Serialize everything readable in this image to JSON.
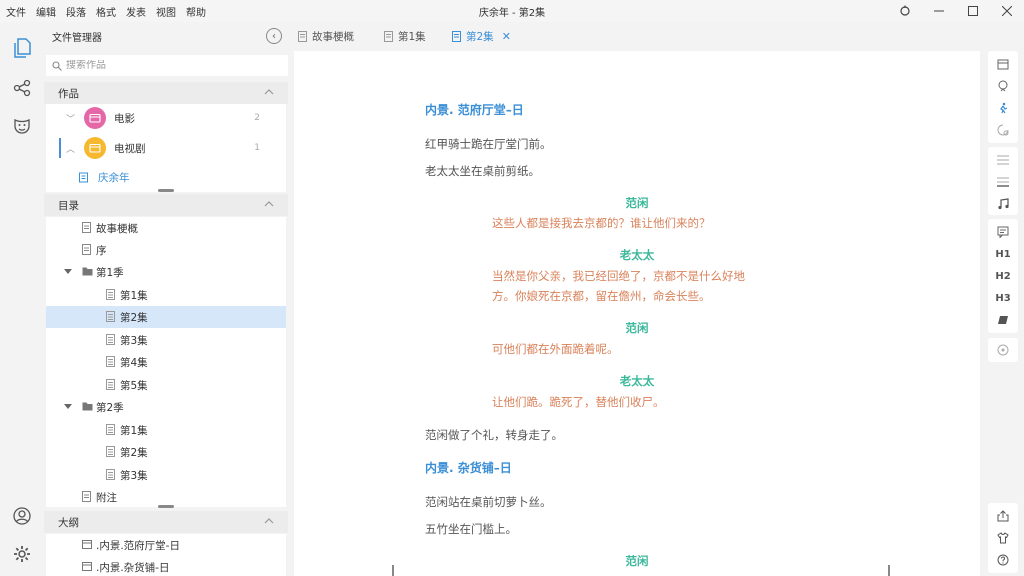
{
  "app": {
    "window_title": "庆余年 - 第2集",
    "menu": [
      "文件",
      "编辑",
      "段落",
      "格式",
      "发表",
      "视图",
      "帮助"
    ]
  },
  "sidebar": {
    "title": "文件管理器",
    "search_placeholder": "搜索作品",
    "works_header": "作品",
    "works": [
      {
        "label": "电影",
        "count": "2",
        "color": "#e667a8"
      },
      {
        "label": "电视剧",
        "count": "1",
        "color": "#f5b82e"
      }
    ],
    "active_work": "庆余年",
    "toc_header": "目录",
    "toc": [
      {
        "label": "故事梗概"
      },
      {
        "label": "序"
      },
      {
        "label": "第1季"
      },
      {
        "label": "第1集"
      },
      {
        "label": "第2集"
      },
      {
        "label": "第3集"
      },
      {
        "label": "第4集"
      },
      {
        "label": "第5集"
      },
      {
        "label": "第2季"
      },
      {
        "label": "第1集"
      },
      {
        "label": "第2集"
      },
      {
        "label": "第3集"
      },
      {
        "label": "附注"
      }
    ],
    "outline_header": "大纲",
    "outline": [
      {
        "label": ".内景.范府厅堂-日"
      },
      {
        "label": ".内景.杂货铺-日"
      }
    ]
  },
  "tabs": [
    {
      "label": "故事梗概"
    },
    {
      "label": "第1集"
    },
    {
      "label": "第2集",
      "active": true
    }
  ],
  "colors": {
    "accent": "#3b8fd6",
    "scene": "#3b8fd6",
    "character": "#3bb89b",
    "dialogue": "#d9825a",
    "selected_row": "#d6e7fa"
  },
  "script": {
    "lines": [
      {
        "type": "scene",
        "text": "内景. 范府厅堂–日"
      },
      {
        "type": "action",
        "text": "红甲骑士跪在厅堂门前。"
      },
      {
        "type": "action",
        "text": "老太太坐在桌前剪纸。"
      },
      {
        "type": "character",
        "text": "范闲"
      },
      {
        "type": "dialogue",
        "text": "这些人都是接我去京都的？谁让他们来的？"
      },
      {
        "type": "character",
        "text": "老太太"
      },
      {
        "type": "dialogue",
        "text": "当然是你父亲，我已经回绝了，京都不是什么好地"
      },
      {
        "type": "dialogue",
        "text": "方。你娘死在京都，留在儋州，命会长些。"
      },
      {
        "type": "character",
        "text": "范闲"
      },
      {
        "type": "dialogue",
        "text": "可他们都在外面跪着呢。"
      },
      {
        "type": "character",
        "text": "老太太"
      },
      {
        "type": "dialogue",
        "text": "让他们跪。跪死了，替他们收尸。"
      },
      {
        "type": "action",
        "text": "范闲做了个礼，转身走了。"
      },
      {
        "type": "scene",
        "text": "内景. 杂货铺–日"
      },
      {
        "type": "action",
        "text": "范闲站在桌前切萝卜丝。"
      },
      {
        "type": "action",
        "text": "五竹坐在门槛上。"
      },
      {
        "type": "character",
        "text": "范闲"
      }
    ]
  },
  "right_toolbar": {
    "headings": [
      "H1",
      "H2",
      "H3"
    ],
    "icons": [
      "scene-icon",
      "character-icon",
      "action-icon",
      "transition-icon",
      "align-icon",
      "align-bottom-icon",
      "music-icon",
      "note-icon",
      "h1-icon",
      "h2-icon",
      "h3-icon",
      "eraser-icon",
      "target-icon",
      "share-icon",
      "shirt-icon",
      "help-icon"
    ]
  }
}
